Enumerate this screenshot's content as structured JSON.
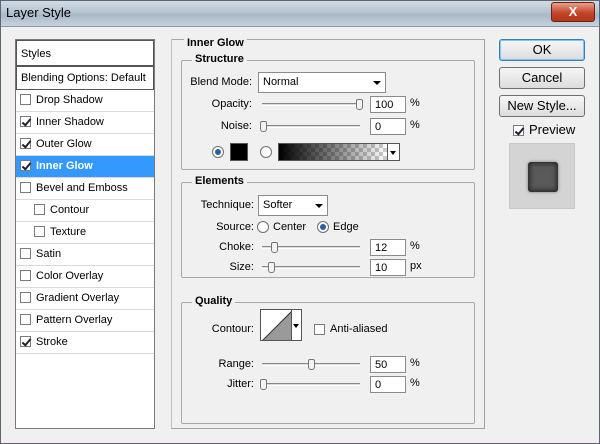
{
  "window": {
    "title": "Layer Style",
    "close": "X"
  },
  "styles_list": {
    "header": "Styles",
    "blending": "Blending Options: Default",
    "items": [
      {
        "label": "Drop Shadow",
        "checked": false
      },
      {
        "label": "Inner Shadow",
        "checked": true
      },
      {
        "label": "Outer Glow",
        "checked": true
      },
      {
        "label": "Inner Glow",
        "checked": true,
        "selected": true
      },
      {
        "label": "Bevel and Emboss",
        "checked": false
      },
      {
        "label": "Contour",
        "checked": false
      },
      {
        "label": "Texture",
        "checked": false
      },
      {
        "label": "Satin",
        "checked": false
      },
      {
        "label": "Color Overlay",
        "checked": false
      },
      {
        "label": "Gradient Overlay",
        "checked": false
      },
      {
        "label": "Pattern Overlay",
        "checked": false
      },
      {
        "label": "Stroke",
        "checked": true
      }
    ]
  },
  "panel": {
    "title": "Inner Glow",
    "structure": {
      "title": "Structure",
      "blend_mode_label": "Blend Mode:",
      "blend_mode_value": "Normal",
      "opacity_label": "Opacity:",
      "opacity_value": "100",
      "opacity_unit": "%",
      "noise_label": "Noise:",
      "noise_value": "0",
      "noise_unit": "%",
      "glow_color": "#000000"
    },
    "elements": {
      "title": "Elements",
      "technique_label": "Technique:",
      "technique_value": "Softer",
      "source_label": "Source:",
      "source_center": "Center",
      "source_edge": "Edge",
      "choke_label": "Choke:",
      "choke_value": "12",
      "choke_unit": "%",
      "size_label": "Size:",
      "size_value": "10",
      "size_unit": "px"
    },
    "quality": {
      "title": "Quality",
      "contour_label": "Contour:",
      "anti_aliased_label": "Anti-aliased",
      "range_label": "Range:",
      "range_value": "50",
      "range_unit": "%",
      "jitter_label": "Jitter:",
      "jitter_value": "0",
      "jitter_unit": "%"
    }
  },
  "buttons": {
    "ok": "OK",
    "cancel": "Cancel",
    "new_style": "New Style...",
    "preview": "Preview"
  }
}
